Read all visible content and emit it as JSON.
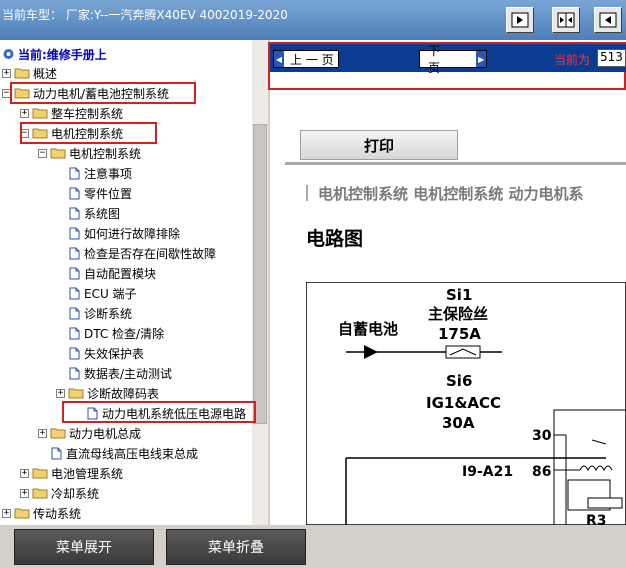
{
  "header": {
    "title": "当前车型：  厂家:Y--一汽奔腾X40EV 4002019-2020"
  },
  "toolbar_buttons": [
    "left-panel-icon",
    "center-split-icon",
    "right-panel-icon"
  ],
  "tree": {
    "root": "当前:维修手册上",
    "nodes": [
      {
        "label": "概述",
        "type": "folder",
        "exp": "+"
      },
      {
        "label": "动力电机/蓄电池控制系统",
        "type": "folder",
        "exp": "-"
      },
      {
        "label": "整车控制系统",
        "type": "folder",
        "exp": "+"
      },
      {
        "label": "电机控制系统",
        "type": "folder",
        "exp": "-"
      },
      {
        "label": "电机控制系统",
        "type": "folder",
        "exp": "-"
      },
      {
        "label": "注意事项",
        "type": "page"
      },
      {
        "label": "零件位置",
        "type": "page"
      },
      {
        "label": "系统图",
        "type": "page"
      },
      {
        "label": "如何进行故障排除",
        "type": "page"
      },
      {
        "label": "检查是否存在间歇性故障",
        "type": "page"
      },
      {
        "label": "自动配置模块",
        "type": "page"
      },
      {
        "label": "ECU 端子",
        "type": "page"
      },
      {
        "label": "诊断系统",
        "type": "page"
      },
      {
        "label": "DTC 检查/清除",
        "type": "page"
      },
      {
        "label": "失效保护表",
        "type": "page"
      },
      {
        "label": "数据表/主动测试",
        "type": "page"
      },
      {
        "label": "诊断故障码表",
        "type": "folder",
        "exp": "+"
      },
      {
        "label": "动力电机系统低压电源电路",
        "type": "page"
      },
      {
        "label": "动力电机总成",
        "type": "folder",
        "exp": "+"
      },
      {
        "label": "直流母线高压电线束总成",
        "type": "page"
      },
      {
        "label": "电池管理系统",
        "type": "folder",
        "exp": "+"
      },
      {
        "label": "冷却系统",
        "type": "folder",
        "exp": "+"
      },
      {
        "label": "传动系统",
        "type": "folder",
        "exp": "+"
      }
    ]
  },
  "bottom": {
    "expand_label": "菜单展开",
    "collapse_label": "菜单折叠"
  },
  "nav": {
    "prev_label": "上 一 页",
    "next_label": "下 一 页",
    "current_label": "当前为",
    "current_page": "513"
  },
  "content": {
    "print_label": "打印",
    "breadcrumbs": "电机控制系统  电机控制系统  动力电机系",
    "section_title": "电路图"
  },
  "diagram": {
    "battery_label": "自蓄电池",
    "fuse1_code": "Si1",
    "fuse1_name": "主保险丝",
    "fuse1_rating": "175A",
    "fuse2_code": "Si6",
    "fuse2_name": "IG1&ACC",
    "fuse2_rating": "30A",
    "connector": "I9-A21",
    "pin30": "30",
    "pin86": "86",
    "relay": "R3"
  },
  "colors": {
    "highlight": "#d32020",
    "nav_strip": "#0a3d91",
    "topbar": "#4f7fb8"
  }
}
